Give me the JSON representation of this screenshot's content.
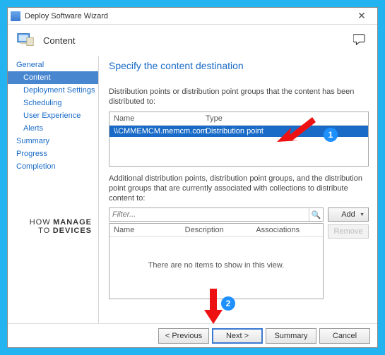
{
  "window": {
    "title": "Deploy Software Wizard",
    "section": "Content"
  },
  "nav": {
    "items": [
      {
        "label": "General",
        "sub": false,
        "sel": false
      },
      {
        "label": "Content",
        "sub": true,
        "sel": true
      },
      {
        "label": "Deployment Settings",
        "sub": true,
        "sel": false
      },
      {
        "label": "Scheduling",
        "sub": true,
        "sel": false
      },
      {
        "label": "User Experience",
        "sub": true,
        "sel": false
      },
      {
        "label": "Alerts",
        "sub": true,
        "sel": false
      },
      {
        "label": "Summary",
        "sub": false,
        "sel": false
      },
      {
        "label": "Progress",
        "sub": false,
        "sel": false
      },
      {
        "label": "Completion",
        "sub": false,
        "sel": false
      }
    ]
  },
  "content": {
    "heading": "Specify the content destination",
    "label1": "Distribution points or distribution point groups that the content has been distributed to:",
    "grid1": {
      "cols": [
        "Name",
        "Type"
      ],
      "rows": [
        {
          "name": "\\\\CMMEMCM.memcm.com",
          "type": "Distribution point"
        }
      ]
    },
    "label2": "Additional distribution points, distribution point groups, and the distribution point groups that are currently associated with collections to distribute content to:",
    "filter_placeholder": "Filter...",
    "add_label": "Add",
    "remove_label": "Remove",
    "grid2": {
      "cols": [
        "Name",
        "Description",
        "Associations"
      ],
      "empty": "There are no items to show in this view."
    }
  },
  "footer": {
    "prev": "< Previous",
    "next": "Next >",
    "summary": "Summary",
    "cancel": "Cancel"
  },
  "annotations": {
    "n1": "1",
    "n2": "2"
  },
  "watermark": {
    "l1": "HOW",
    "l2": "MANAGE",
    "l3": "TO",
    "l4": "DEVICES"
  }
}
